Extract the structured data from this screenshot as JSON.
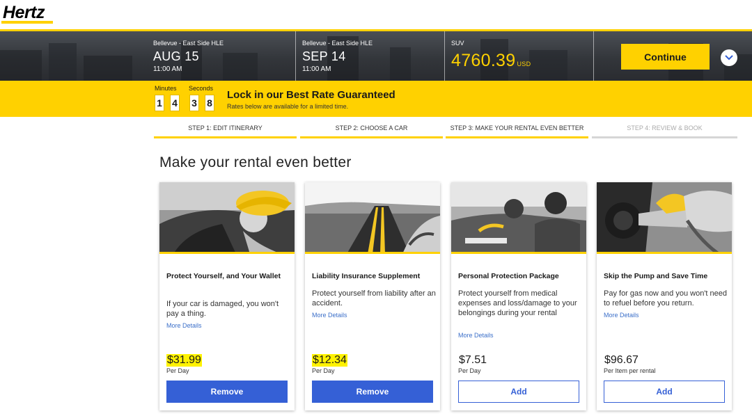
{
  "brand": {
    "logo_text": "Hertz",
    "accent": "#ffd100",
    "link": "#3b6fc9",
    "button_blue": "#3560d6"
  },
  "itinerary": {
    "pickup": {
      "location": "Bellevue - East Side HLE",
      "date": "AUG 15",
      "time": "11:00 AM"
    },
    "dropoff": {
      "location": "Bellevue - East Side HLE",
      "date": "SEP 14",
      "time": "11:00 AM"
    },
    "vehicle": {
      "class": "SUV",
      "total": "4760.39",
      "currency": "USD"
    },
    "continue_label": "Continue",
    "expand_icon": "chevron-down-icon"
  },
  "promo": {
    "minutes_label": "Minutes",
    "seconds_label": "Seconds",
    "minutes_digits": [
      "1",
      "4"
    ],
    "seconds_digits": [
      "3",
      "8"
    ],
    "title": "Lock in our Best Rate Guaranteed",
    "subtitle": "Rates below are available for a limited time."
  },
  "steps": [
    {
      "label": "STEP 1:  EDIT ITINERARY",
      "state": "complete"
    },
    {
      "label": "STEP 2:  CHOOSE A CAR",
      "state": "complete"
    },
    {
      "label": "STEP 3:  MAKE YOUR RENTAL EVEN BETTER",
      "state": "current"
    },
    {
      "label": "STEP 4:  REVIEW & BOOK",
      "state": "upcoming"
    }
  ],
  "page_title": "Make your rental even better",
  "cards": [
    {
      "title": "Protect Yourself, and Your Wallet",
      "description": "If your car is damaged, you won't pay a thing.",
      "more_label": "More Details",
      "price": "$31.99",
      "price_unit": "Per Day",
      "action": "Remove",
      "highlighted": true
    },
    {
      "title": "Liability Insurance Supplement",
      "description": "Protect yourself from liability after an accident.",
      "more_label": "More Details",
      "price": "$12.34",
      "price_unit": "Per Day",
      "action": "Remove",
      "highlighted": true
    },
    {
      "title": "Personal Protection Package",
      "description": "Protect yourself from medical expenses and loss/damage to your belongings during your rental",
      "more_label": "More Details",
      "price": "$7.51",
      "price_unit": "Per Day",
      "action": "Add",
      "highlighted": false
    },
    {
      "title": "Skip the Pump and Save Time",
      "description": "Pay for gas now and you won't need to refuel before you return.",
      "more_label": "More Details",
      "price": "$96.67",
      "price_unit": "Per Item per rental",
      "action": "Add",
      "highlighted": false
    }
  ]
}
